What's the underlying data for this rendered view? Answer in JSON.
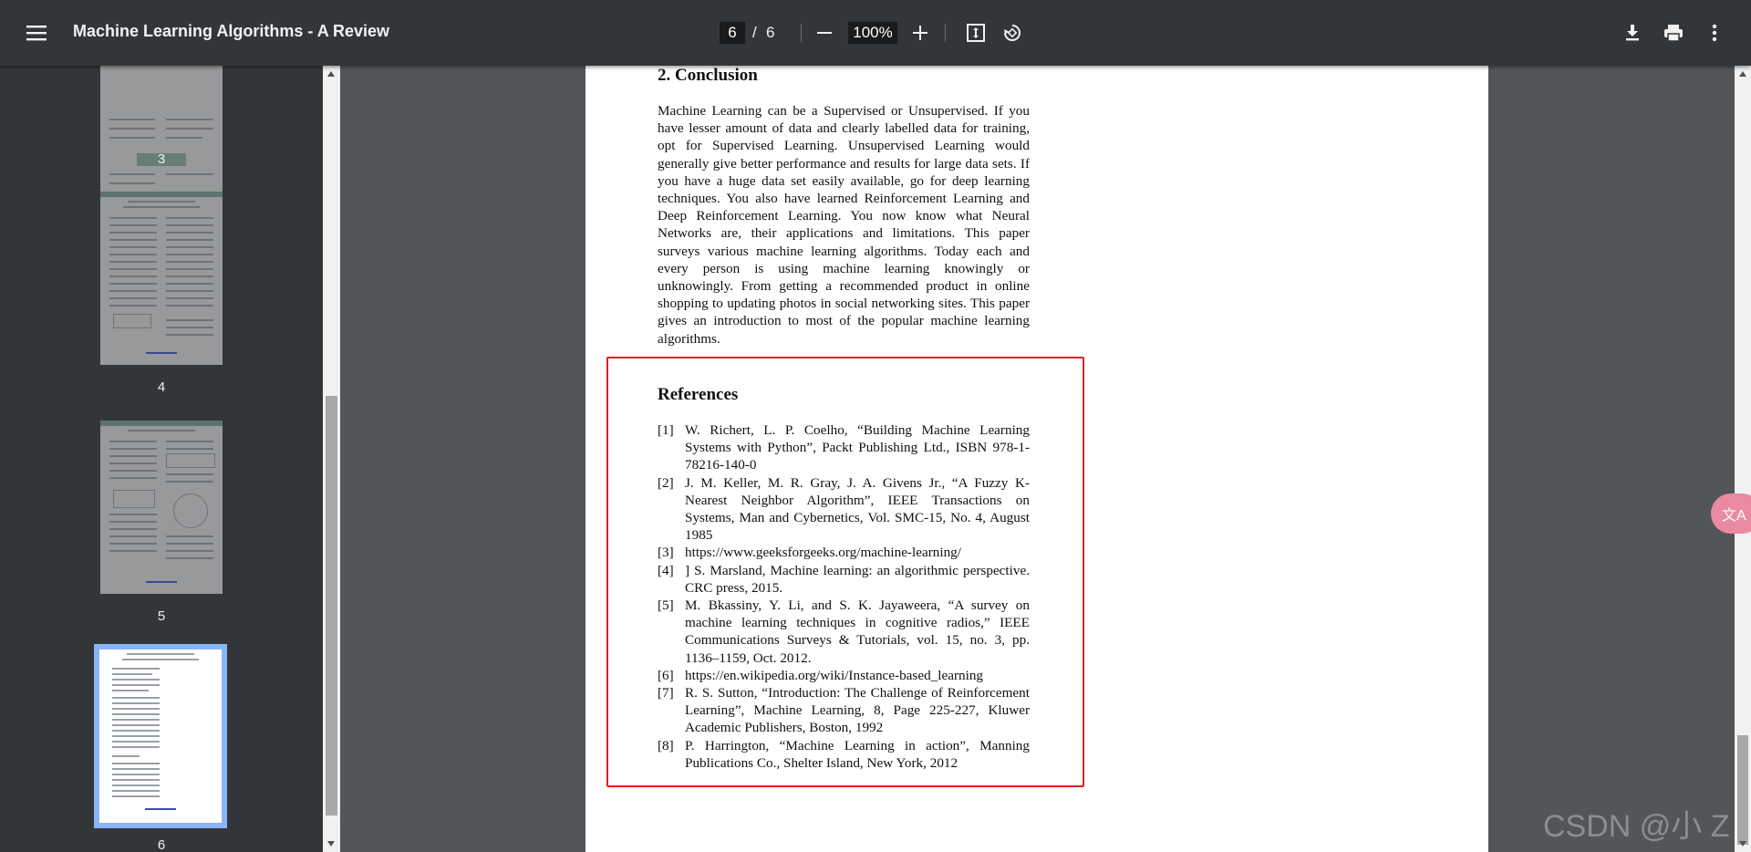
{
  "toolbar": {
    "title": "Machine Learning Algorithms - A Review",
    "current_page": "6",
    "page_separator": "/",
    "total_pages": "6",
    "zoom": "100%",
    "icons": [
      "menu-icon",
      "zoom-out-icon",
      "zoom-in-icon",
      "fit-page-icon",
      "rotate-icon",
      "download-icon",
      "print-icon",
      "more-vert-icon"
    ]
  },
  "sidebar": {
    "thumbnails": [
      {
        "label": "3"
      },
      {
        "label": "4"
      },
      {
        "label": "5"
      },
      {
        "label": "6",
        "selected": true
      }
    ]
  },
  "document": {
    "section_heading": "2. Conclusion",
    "conclusion": "Machine Learning can be a Supervised or Unsupervised. If you have lesser amount of data and clearly labelled data for training, opt for Supervised Learning. Unsupervised Learning would generally give better performance and results for large data sets. If you have a huge data set easily available, go for deep learning techniques. You also have learned Reinforcement Learning and Deep Reinforcement Learning. You now know what Neural Networks are, their applications and limitations. This paper surveys various machine learning algorithms. Today each and every person is using machine learning knowingly or unknowingly. From getting a recommended product in online shopping to updating photos in social networking sites. This paper gives an introduction to most of the popular machine learning algorithms.",
    "references_heading": "References",
    "references": [
      {
        "num": "[1]",
        "text": "W. Richert, L. P. Coelho, “Building Machine Learning Systems with Python”, Packt Publishing Ltd., ISBN 978-1-78216-140-0"
      },
      {
        "num": "[2]",
        "text": "J. M. Keller, M. R. Gray, J. A. Givens Jr., “A Fuzzy K-Nearest Neighbor Algorithm”, IEEE Transactions on Systems, Man and Cybernetics, Vol. SMC-15, No. 4, August 1985"
      },
      {
        "num": "[3]",
        "text": "https://www.geeksforgeeks.org/machine-learning/"
      },
      {
        "num": "[4]",
        "text": "] S. Marsland, Machine learning: an algorithmic perspective. CRC press, 2015."
      },
      {
        "num": "[5]",
        "text": "M. Bkassiny, Y. Li, and S. K. Jayaweera, “A survey on machine learning techniques in cognitive radios,” IEEE Communications Surveys & Tutorials, vol. 15, no. 3, pp. 1136–1159, Oct. 2012."
      },
      {
        "num": "[6]",
        "text": "https://en.wikipedia.org/wiki/Instance-based_learning"
      },
      {
        "num": "[7]",
        "text": "R. S. Sutton, “Introduction: The Challenge of Reinforcement Learning”, Machine Learning, 8, Page 225-227, Kluwer Academic Publishers, Boston, 1992"
      },
      {
        "num": "[8]",
        "text": "P. Harrington, “Machine Learning in action”, Manning Publications Co., Shelter Island, New York, 2012"
      }
    ]
  },
  "overlay": {
    "translate_label": "文A",
    "watermark": "CSDN @小 Z",
    "highlight_color": "#e02020"
  }
}
